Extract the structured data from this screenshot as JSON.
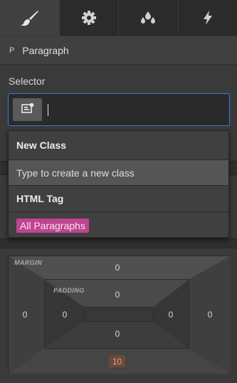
{
  "tabs": [
    {
      "icon": "paintbrush-icon",
      "active": true
    },
    {
      "icon": "gear-icon",
      "active": false
    },
    {
      "icon": "droplets-icon",
      "active": false
    },
    {
      "icon": "lightning-icon",
      "active": false
    }
  ],
  "element": {
    "tag": "P",
    "name": "Paragraph"
  },
  "selector": {
    "label": "Selector",
    "value": ""
  },
  "dropdown": {
    "new_class_header": "New Class",
    "new_class_hint": "Type to create a new class",
    "html_tag_header": "HTML Tag",
    "html_tag_option": "All Paragraphs"
  },
  "spacing": {
    "margin_label": "MARGIN",
    "padding_label": "PADDING",
    "margin": {
      "top": "0",
      "right": "0",
      "bottom": "10",
      "left": "0"
    },
    "padding": {
      "top": "0",
      "right": "0",
      "bottom": "0",
      "left": "0"
    }
  },
  "colors": {
    "accent_blue": "#2d7fd6",
    "tag_pink": "#c0448f",
    "margin_bottom_highlight": "#6b4a3a"
  }
}
